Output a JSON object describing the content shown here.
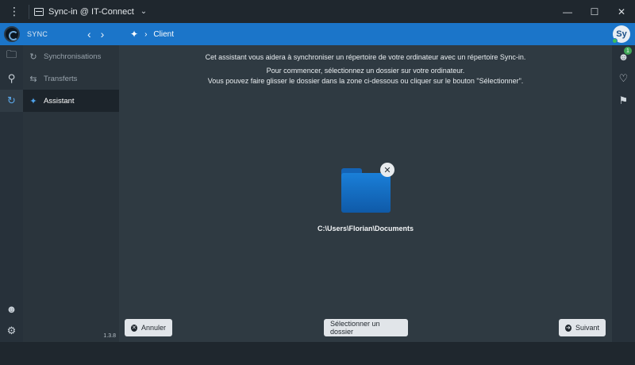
{
  "window": {
    "title": "Sync-in @ IT-Connect",
    "menu_icon": "more-vertical-icon",
    "controls": [
      "minimize",
      "maximize",
      "close"
    ]
  },
  "header": {
    "section_label": "SYNC",
    "breadcrumb": "Client",
    "avatar_initials": "Sy",
    "accent_color": "#1b75c9"
  },
  "sidebar": {
    "items": [
      {
        "label": "Synchronisations",
        "icon": "sync-icon"
      },
      {
        "label": "Transferts",
        "icon": "transfer-icon"
      },
      {
        "label": "Assistant",
        "icon": "wand-icon"
      }
    ],
    "version": "1.3.8"
  },
  "right_rail": {
    "notification_count": "1"
  },
  "main": {
    "intro_line1": "Cet assistant vous aidera à synchroniser un répertoire de votre ordinateur avec un répertoire Sync-in.",
    "intro_line2": "Pour commencer, sélectionnez un dossier sur votre ordinateur.",
    "intro_line3": "Vous pouvez faire glisser le dossier dans la zone ci-dessous ou cliquer sur le bouton \"Sélectionner\".",
    "selected_path": "C:\\Users\\Florian\\Documents",
    "folder_color": "#1a7fd8"
  },
  "buttons": {
    "cancel": "Annuler",
    "select": "Sélectionner un dossier",
    "next": "Suivant"
  }
}
